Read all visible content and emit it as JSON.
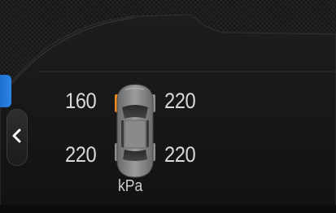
{
  "colors": {
    "background": "#151515",
    "panel": "#1a1a1a",
    "accent_blue": "#2b86e8",
    "warning_tire": "#f08a1c",
    "normal_tire": "#9a9a9a",
    "text": "#d8d8d8"
  },
  "navigation": {
    "back_icon": "chevron-left-icon"
  },
  "tire_pressure": {
    "front_left": "160",
    "front_right": "220",
    "rear_left": "220",
    "rear_right": "220",
    "unit": "kPa",
    "warning_tire": "front_left"
  }
}
